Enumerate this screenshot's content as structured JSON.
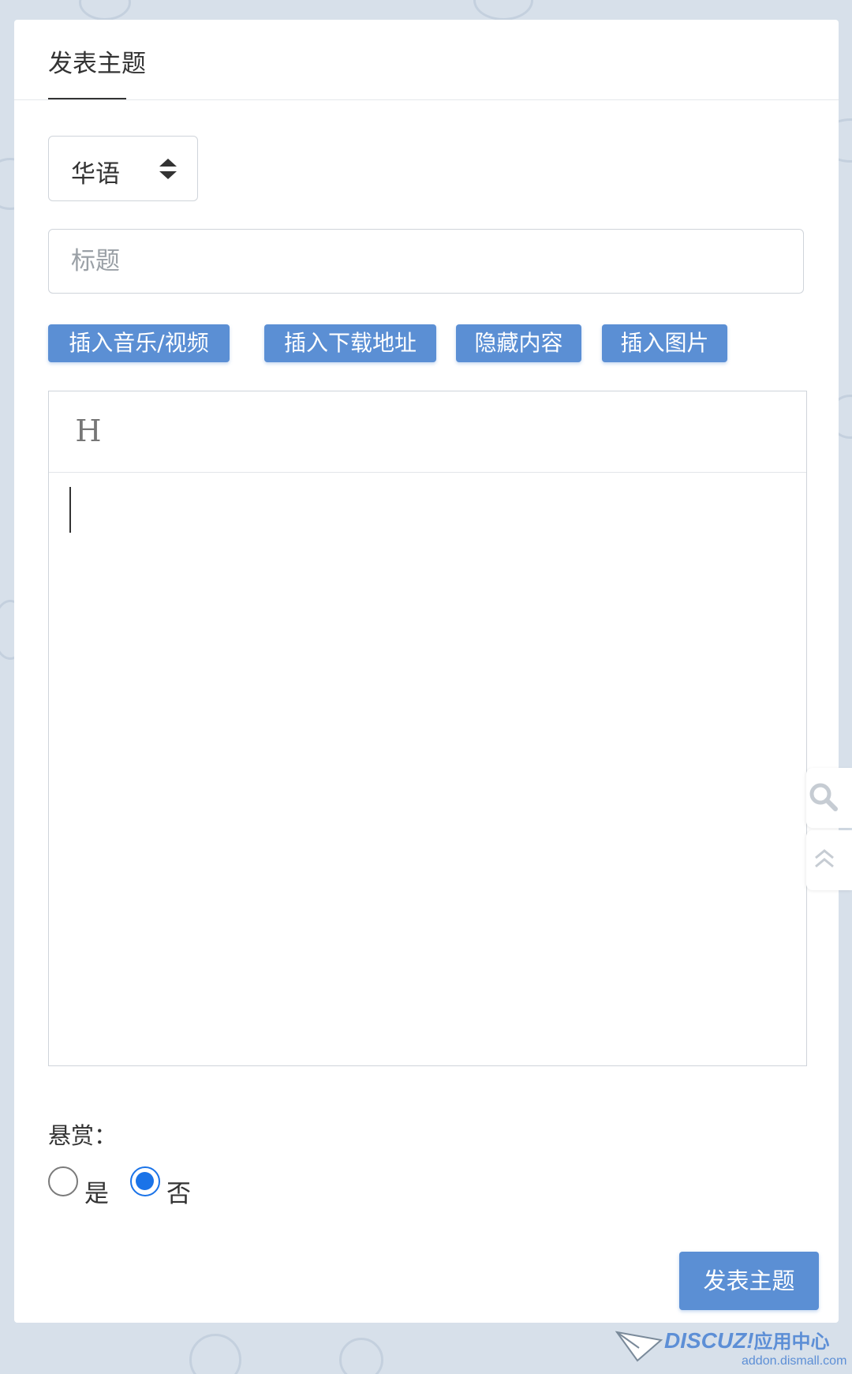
{
  "header": {
    "tab_label": "发表主题"
  },
  "form": {
    "language_select": {
      "selected": "华语"
    },
    "title_input": {
      "placeholder": "标题",
      "value": ""
    },
    "tool_buttons": [
      {
        "label": "插入音乐/视频"
      },
      {
        "label": "插入下载地址"
      },
      {
        "label": "隐藏内容"
      },
      {
        "label": "插入图片"
      }
    ],
    "editor": {
      "heading_button": "H",
      "content": ""
    },
    "reward": {
      "label": "悬赏：",
      "options": [
        {
          "label": "是",
          "checked": false
        },
        {
          "label": "否",
          "checked": true
        }
      ]
    },
    "submit_label": "发表主题"
  },
  "side_tools": {
    "icons": [
      "search-icon",
      "back-to-top-icon"
    ]
  },
  "watermark": {
    "brand": "DISCUZ!",
    "suffix": "应用中心",
    "url": "addon.dismall.com"
  },
  "colors": {
    "accent": "#5b8fd4",
    "radio_checked": "#1a73e8",
    "background": "#d7e0ea",
    "card": "#ffffff"
  }
}
